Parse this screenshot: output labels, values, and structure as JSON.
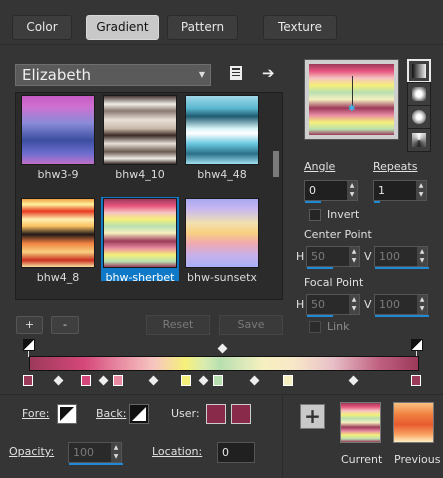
{
  "tabs": [
    "Color",
    "Gradient",
    "Pattern",
    "Texture"
  ],
  "active_tab": "Gradient",
  "preset_dropdown": {
    "value": "Elizabeth"
  },
  "icons": {
    "library": "book-icon",
    "export": "arrow-right-icon"
  },
  "thumbnails": [
    {
      "label": "bhw3-9",
      "selected": false
    },
    {
      "label": "bhw4_10",
      "selected": false
    },
    {
      "label": "bhw4_48",
      "selected": false
    },
    {
      "label": "bhw4_8",
      "selected": false
    },
    {
      "label": "bhw-sherbet",
      "selected": true
    },
    {
      "label": "bhw-sunsetx",
      "selected": false
    }
  ],
  "buttons": {
    "add": "+",
    "remove": "-",
    "reset": "Reset",
    "save": "Save",
    "add_current": "+"
  },
  "angle": {
    "label": "Angle",
    "value": "0"
  },
  "repeats": {
    "label": "Repeats",
    "value": "1"
  },
  "invert": {
    "label": "Invert",
    "checked": false
  },
  "center_point": {
    "label": "Center Point",
    "h_label": "H",
    "h": "50",
    "v_label": "V",
    "v": "100"
  },
  "focal_point": {
    "label": "Focal Point",
    "h_label": "H",
    "h": "50",
    "v_label": "V",
    "v": "100"
  },
  "link": {
    "label": "Link",
    "checked": false
  },
  "fore": {
    "label": "Fore:"
  },
  "back": {
    "label": "Back:"
  },
  "user": {
    "label": "User:",
    "colors": [
      "#8a2a4a",
      "#8a2a4a"
    ]
  },
  "opacity": {
    "label": "Opacity:",
    "value": "100"
  },
  "location": {
    "label": "Location:",
    "value": "0"
  },
  "current": {
    "label": "Current"
  },
  "previous": {
    "label": "Previous"
  },
  "stop_colors": [
    "#9c3a5a",
    "#d5477a",
    "#e88aa2",
    "#f5f07a",
    "#b8dfb0",
    "#f6f0c0",
    "#9c3a5a"
  ]
}
